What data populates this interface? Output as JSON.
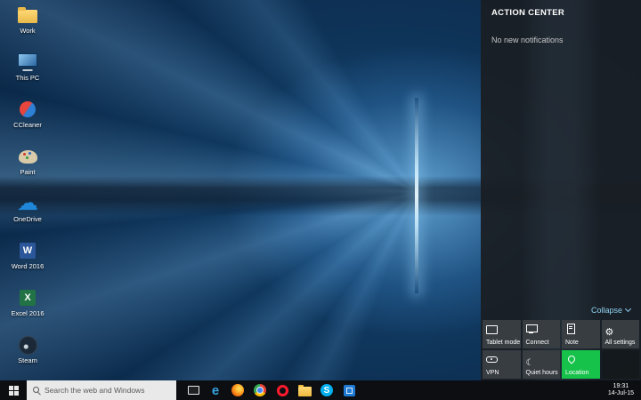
{
  "colors": {
    "accent_green": "#17c24b",
    "link_blue": "#8fd2f2"
  },
  "desktop": {
    "icons": [
      {
        "label": "Work",
        "icon": "folder-icon"
      },
      {
        "label": "This PC",
        "icon": "this-pc-icon"
      },
      {
        "label": "CCleaner",
        "icon": "ccleaner-icon"
      },
      {
        "label": "Paint",
        "icon": "paint-icon"
      },
      {
        "label": "OneDrive",
        "icon": "onedrive-cloud-icon"
      },
      {
        "label": "Word 2016",
        "icon": "word-icon"
      },
      {
        "label": "Excel 2016",
        "icon": "excel-icon"
      },
      {
        "label": "Steam",
        "icon": "steam-icon"
      }
    ]
  },
  "action_center": {
    "title": "ACTION CENTER",
    "status": "No new notifications",
    "collapse_label": "Collapse",
    "tiles": [
      {
        "label": "Tablet mode",
        "icon": "tablet-mode-icon",
        "active": false
      },
      {
        "label": "Connect",
        "icon": "connect-icon",
        "active": false
      },
      {
        "label": "Note",
        "icon": "note-icon",
        "active": false
      },
      {
        "label": "All settings",
        "icon": "settings-gear-icon",
        "active": false
      },
      {
        "label": "VPN",
        "icon": "vpn-icon",
        "active": false
      },
      {
        "label": "Quiet hours",
        "icon": "quiet-hours-moon-icon",
        "active": false
      },
      {
        "label": "Location",
        "icon": "location-pin-icon",
        "active": true
      }
    ]
  },
  "taskbar": {
    "search_placeholder": "Search the web and Windows",
    "apps": [
      {
        "name": "edge"
      },
      {
        "name": "firefox"
      },
      {
        "name": "chrome"
      },
      {
        "name": "opera"
      },
      {
        "name": "file-explorer"
      },
      {
        "name": "skype"
      },
      {
        "name": "store"
      }
    ],
    "clock": {
      "time": "19:31",
      "date": "14-Jul-15"
    }
  }
}
